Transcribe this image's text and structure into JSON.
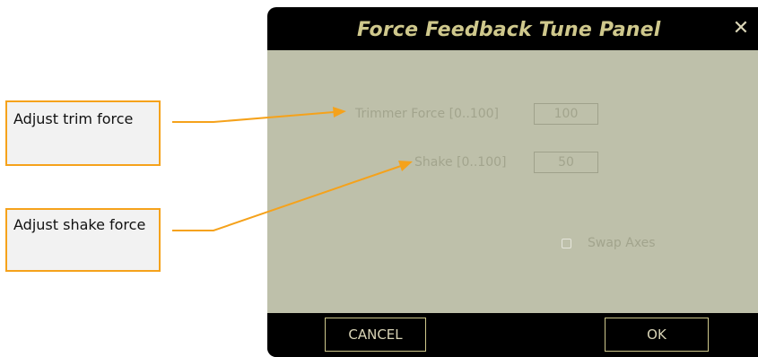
{
  "callouts": {
    "trim_text": "Adjust trim force",
    "shake_text": "Adjust shake force",
    "border_color": "#f5a21b"
  },
  "dialog": {
    "title": "Force Feedback Tune Panel",
    "close_icon": "close-icon",
    "close_glyph": "✕",
    "trimmer_label": "Trimmer Force [0..100]",
    "trimmer_value": "100",
    "shake_label": "Shake [0..100]",
    "shake_value": "50",
    "swap_axes_label": "Swap Axes",
    "swap_axes_checked": false,
    "cancel_label": "CANCEL",
    "ok_label": "OK",
    "colors": {
      "title": "#cfc88c",
      "panel": "#bec0aa",
      "frame": "#000000"
    }
  }
}
